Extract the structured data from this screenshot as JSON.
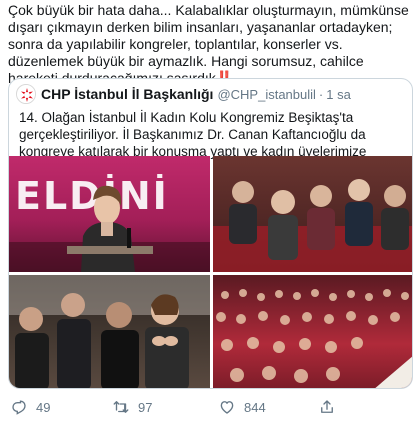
{
  "tweet": {
    "text": "Çok büyük bir hata daha... Kalabalıklar oluşturmayın, mümkünse dışarı çıkmayın derken bilim insanları, yaşananlar ortadayken; sonra da yapılabilir kongreler, toplantılar, konserler vs. düzenlemek büyük bir aymazlık. Hangi sorumsuz, cahilce hareketi durduracağımızı şaşırdık",
    "warning_emoji": "‼️"
  },
  "quoted_tweet": {
    "name": "CHP İstanbul İl Başkanlığı",
    "handle": "@CHP_istanbulil",
    "dot": "·",
    "time": "1 sa",
    "text": "14. Olağan İstanbul İl Kadın Kolu Kongremiz Beşiktaş'ta gerçekleştiriliyor. İl Başkanımız Dr. Canan Kaftancıoğlu da kongreye katılarak bir konuşma yaptı ve kadın üyelerimize  başarılar diledi.",
    "banner_text": "ELDİNİ",
    "photos": [
      "speaker-at-podium",
      "seated-women-audience",
      "applauding-attendees",
      "congress-hall-audience"
    ]
  },
  "actions": {
    "reply_count": "49",
    "retweet_count": "97",
    "like_count": "844",
    "icons": [
      "reply-icon",
      "retweet-icon",
      "heart-icon",
      "share-icon"
    ]
  },
  "colors": {
    "text": "#14171a",
    "muted": "#657786",
    "border": "#ccd6dd",
    "warning": "#e0245e",
    "chp_red": "#e30a17"
  }
}
